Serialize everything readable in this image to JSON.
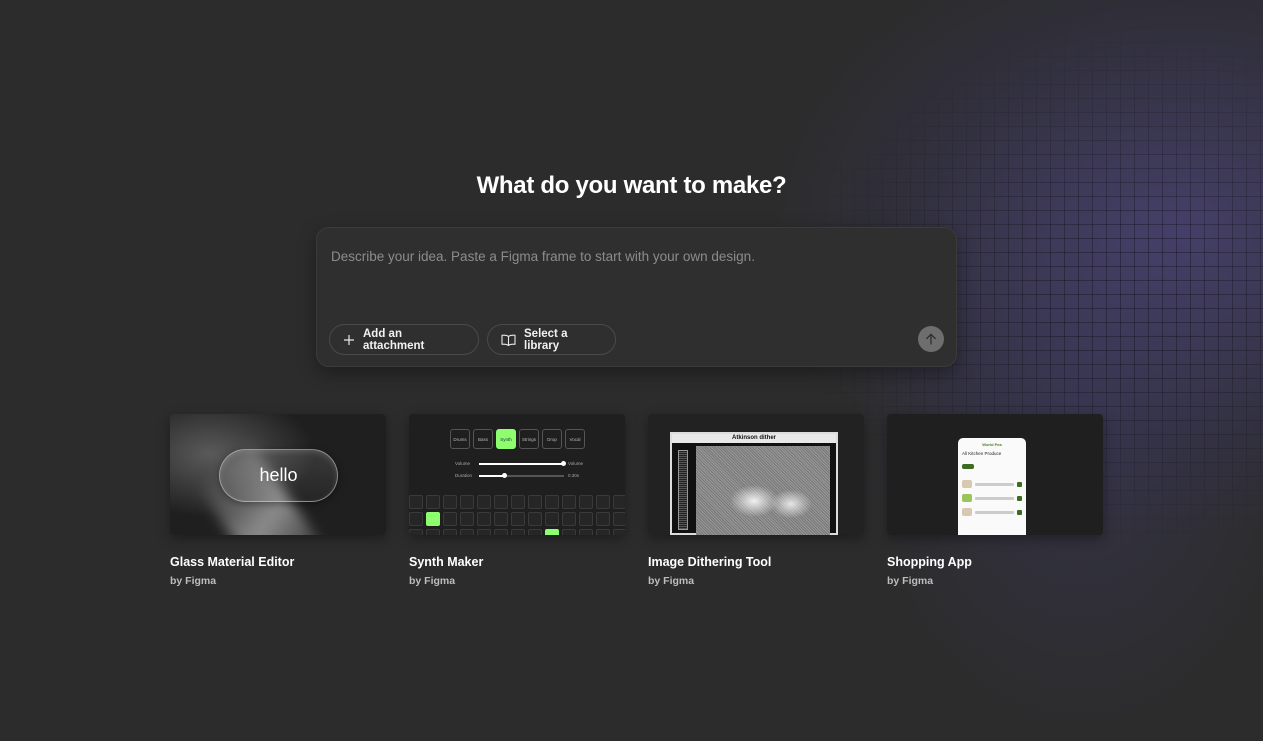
{
  "headline": "What do you want to make?",
  "prompt": {
    "placeholder": "Describe your idea. Paste a Figma frame to start with your own design.",
    "value": "",
    "attach_label": "Add an attachment",
    "library_label": "Select a library",
    "send_icon": "arrow-up-icon"
  },
  "colors": {
    "background": "#2c2c2c",
    "accent_glow": "#584e96",
    "synth_green": "#8dff6e"
  },
  "templates": [
    {
      "title": "Glass Material Editor",
      "author": "by Figma",
      "preview_text": "hello"
    },
    {
      "title": "Synth Maker",
      "author": "by Figma",
      "tabs": [
        "Drums",
        "Bass",
        "Synth",
        "Strings",
        "Drop",
        "Vocal"
      ],
      "active_tab": "Synth",
      "sliders": [
        {
          "label": "Volume",
          "value_label": "Volume",
          "level": 1.0
        },
        {
          "label": "Duration",
          "value_label": "0.30s",
          "level": 0.3
        }
      ]
    },
    {
      "title": "Image Dithering Tool",
      "author": "by Figma",
      "preview_heading": "Atkinson dither"
    },
    {
      "title": "Shopping App",
      "author": "by Figma",
      "brand": "World Pea",
      "screen_title": "All Kitchen Produce"
    }
  ]
}
